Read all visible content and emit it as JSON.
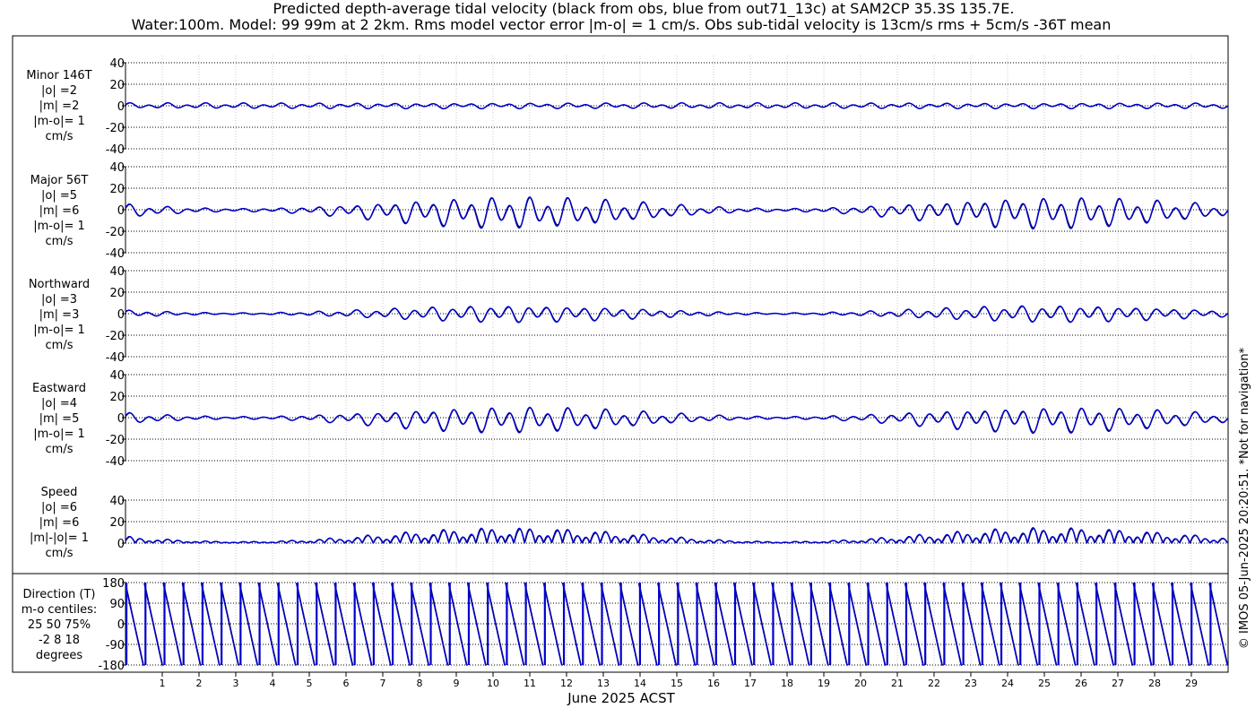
{
  "chart_data": {
    "type": "line",
    "title_line1": "Predicted depth-average tidal velocity (black from obs, blue from out71_13c) at SAM2CP 35.3S 135.7E.",
    "title_line2": "Water:100m. Model: 99 99m at 2 2km. Rms model vector error |m-o| = 1 cm/s. Obs sub-tidal velocity is 13cm/s rms + 5cm/s -36T mean",
    "xlabel": "June 2025 ACST",
    "x_tick_labels": [
      "1",
      "2",
      "3",
      "4",
      "5",
      "6",
      "7",
      "8",
      "9",
      "10",
      "11",
      "12",
      "13",
      "14",
      "15",
      "16",
      "17",
      "18",
      "19",
      "20",
      "21",
      "22",
      "23",
      "24",
      "25",
      "26",
      "27",
      "28",
      "29"
    ],
    "xlim_days": [
      0,
      30
    ],
    "grid": true,
    "credit": "© IMOS 05-Jun-2025 20:20:51. *Not for navigation*",
    "series_colors": {
      "obs": "#000000",
      "model": "#0000cc"
    },
    "panels": [
      {
        "label_lines": [
          "Minor 146T",
          "|o| =2",
          "|m| =2",
          "|m-o|= 1",
          "cm/s"
        ],
        "ylim": [
          -40,
          40
        ],
        "yticks": [
          -40,
          -20,
          0,
          20,
          40
        ],
        "kind": "minor",
        "amplitude": 2
      },
      {
        "label_lines": [
          "Major 56T",
          "|o| =5",
          "|m| =6",
          "|m-o|= 1",
          "cm/s"
        ],
        "ylim": [
          -40,
          40
        ],
        "yticks": [
          -40,
          -20,
          0,
          20,
          40
        ],
        "kind": "major",
        "amplitude": 11
      },
      {
        "label_lines": [
          "Northward",
          "|o| =3",
          "|m| =3",
          "|m-o|= 1",
          "cm/s"
        ],
        "ylim": [
          -40,
          40
        ],
        "yticks": [
          -40,
          -20,
          0,
          20,
          40
        ],
        "kind": "north",
        "amplitude": 6
      },
      {
        "label_lines": [
          "Eastward",
          "|o| =4",
          "|m| =5",
          "|m-o|= 1",
          "cm/s"
        ],
        "ylim": [
          -40,
          40
        ],
        "yticks": [
          -40,
          -20,
          0,
          20,
          40
        ],
        "kind": "east",
        "amplitude": 9
      },
      {
        "label_lines": [
          "Speed",
          "|o| =6",
          "|m| =6",
          "|m|-|o|= 1",
          "cm/s"
        ],
        "ylim": [
          0,
          40
        ],
        "yticks": [
          0,
          20,
          40
        ],
        "kind": "speed",
        "amplitude": 12
      },
      {
        "label_lines": [
          "Direction (T)",
          "m-o centiles:",
          "25  50  75%",
          "-2   8  18",
          "degrees"
        ],
        "ylim": [
          -180,
          180
        ],
        "yticks": [
          -180,
          -90,
          0,
          90,
          180
        ],
        "kind": "direction",
        "amplitude": 180
      }
    ]
  }
}
